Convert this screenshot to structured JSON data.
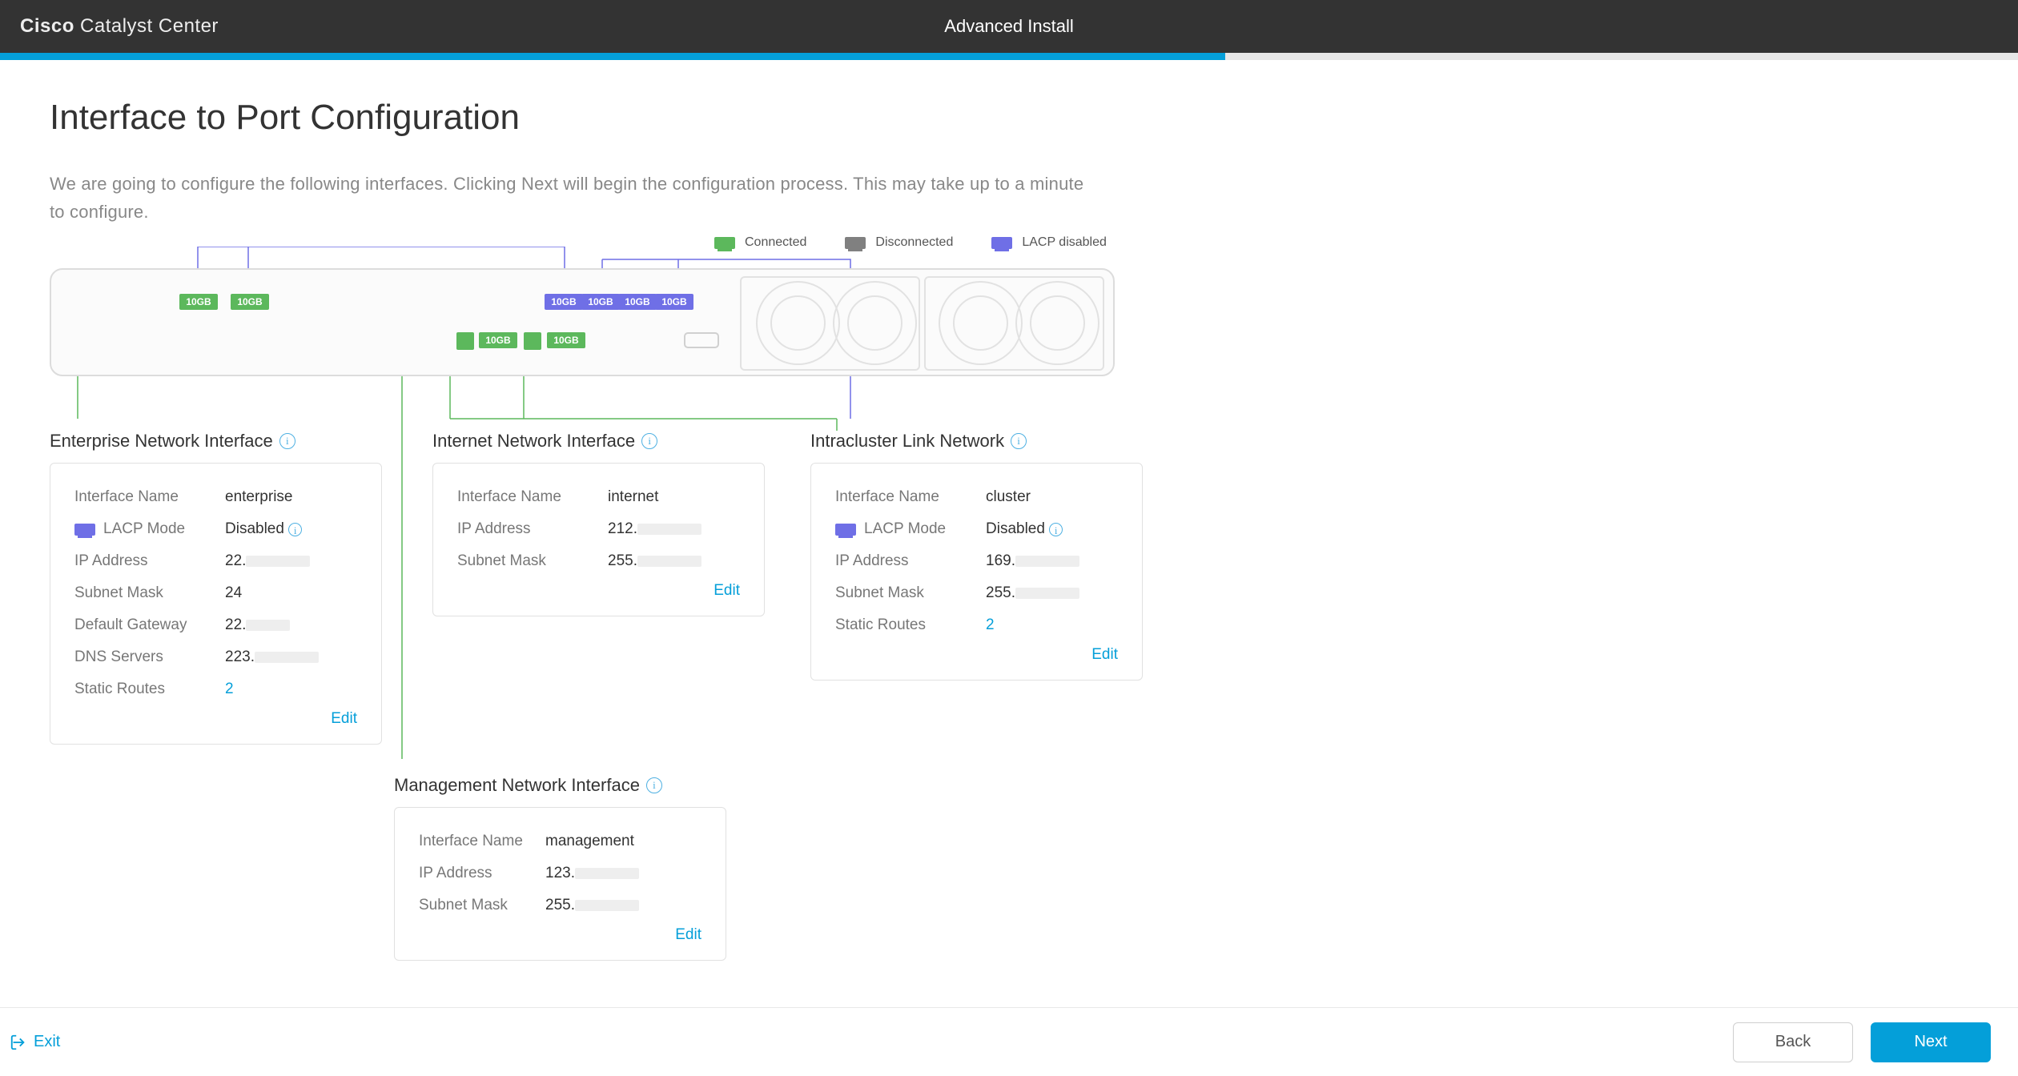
{
  "header": {
    "brand_bold": "Cisco",
    "brand_rest": " Catalyst Center",
    "center": "Advanced Install",
    "progress_pct": 60.7
  },
  "page": {
    "title": "Interface to Port Configuration",
    "description": "We are going to configure the following interfaces. Clicking Next will begin the configuration process. This may take up to a minute to configure."
  },
  "legend": {
    "connected": "Connected",
    "disconnected": "Disconnected",
    "lacp_disabled": "LACP disabled"
  },
  "ports": {
    "speed_label": "10GB"
  },
  "cards": {
    "enterprise": {
      "title": "Enterprise Network Interface",
      "fields": {
        "iface_label": "Interface Name",
        "iface_value": "enterprise",
        "lacp_label": "LACP Mode",
        "lacp_value": "Disabled",
        "ip_label": "IP Address",
        "ip_value": "22.",
        "mask_label": "Subnet Mask",
        "mask_value": "24",
        "gw_label": "Default Gateway",
        "gw_value": "22.",
        "dns_label": "DNS Servers",
        "dns_value": "223.",
        "routes_label": "Static Routes",
        "routes_value": "2"
      },
      "edit": "Edit"
    },
    "internet": {
      "title": "Internet Network Interface",
      "fields": {
        "iface_label": "Interface Name",
        "iface_value": "internet",
        "ip_label": "IP Address",
        "ip_value": "212.",
        "mask_label": "Subnet Mask",
        "mask_value": "255."
      },
      "edit": "Edit"
    },
    "cluster": {
      "title": "Intracluster Link Network",
      "fields": {
        "iface_label": "Interface Name",
        "iface_value": "cluster",
        "lacp_label": "LACP Mode",
        "lacp_value": "Disabled",
        "ip_label": "IP Address",
        "ip_value": "169.",
        "mask_label": "Subnet Mask",
        "mask_value": "255.",
        "routes_label": "Static Routes",
        "routes_value": "2"
      },
      "edit": "Edit"
    },
    "management": {
      "title": "Management Network Interface",
      "fields": {
        "iface_label": "Interface Name",
        "iface_value": "management",
        "ip_label": "IP Address",
        "ip_value": "123.",
        "mask_label": "Subnet Mask",
        "mask_value": "255."
      },
      "edit": "Edit"
    }
  },
  "footer": {
    "exit": "Exit",
    "back": "Back",
    "next": "Next"
  }
}
